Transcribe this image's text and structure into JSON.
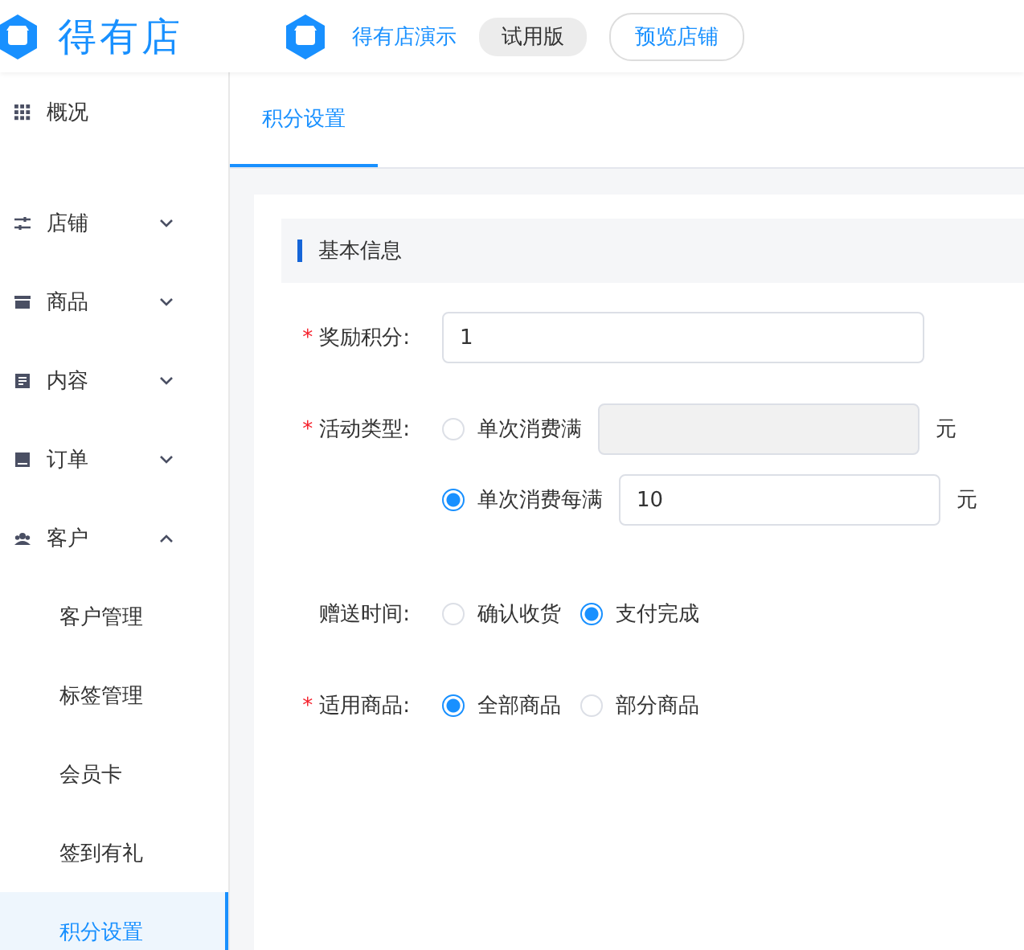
{
  "header": {
    "logo_text": "得有店",
    "shop_name": "得有店演示",
    "badge": "试用版",
    "preview_button": "预览店铺"
  },
  "sidebar": {
    "items": [
      {
        "label": "概况"
      },
      {
        "label": "店铺",
        "expanded": false
      },
      {
        "label": "商品",
        "expanded": false
      },
      {
        "label": "内容",
        "expanded": false
      },
      {
        "label": "订单",
        "expanded": false
      },
      {
        "label": "客户",
        "expanded": true,
        "children": [
          {
            "label": "客户管理",
            "selected": false
          },
          {
            "label": "标签管理",
            "selected": false
          },
          {
            "label": "会员卡",
            "selected": false
          },
          {
            "label": "签到有礼",
            "selected": false
          },
          {
            "label": "积分设置",
            "selected": true
          }
        ]
      }
    ]
  },
  "tabs": [
    {
      "label": "积分设置",
      "selected": true
    }
  ],
  "section_title": "基本信息",
  "form": {
    "fields": [
      {
        "label": "奖励积分:",
        "required_mark": "*",
        "kind": "input",
        "value": "1"
      },
      {
        "label": "活动类型:",
        "required_mark": "*",
        "kind": "radio_inputs",
        "options": [
          {
            "label": "单次消费满",
            "selected": false,
            "input": {
              "disabled": true
            },
            "unit": "元"
          },
          {
            "label": "单次消费每满",
            "selected": true,
            "input": {
              "disabled": false,
              "value": "10"
            },
            "unit": "元"
          }
        ]
      },
      {
        "label": "赠送时间:",
        "kind": "radio_group",
        "options": [
          {
            "label": "确认收货",
            "selected": false
          },
          {
            "label": "支付完成",
            "selected": true
          }
        ]
      },
      {
        "label": "适用商品:",
        "required_mark": "*",
        "kind": "radio_group",
        "options": [
          {
            "label": "全部商品",
            "selected": true
          },
          {
            "label": "部分商品",
            "selected": false
          }
        ]
      }
    ]
  }
}
